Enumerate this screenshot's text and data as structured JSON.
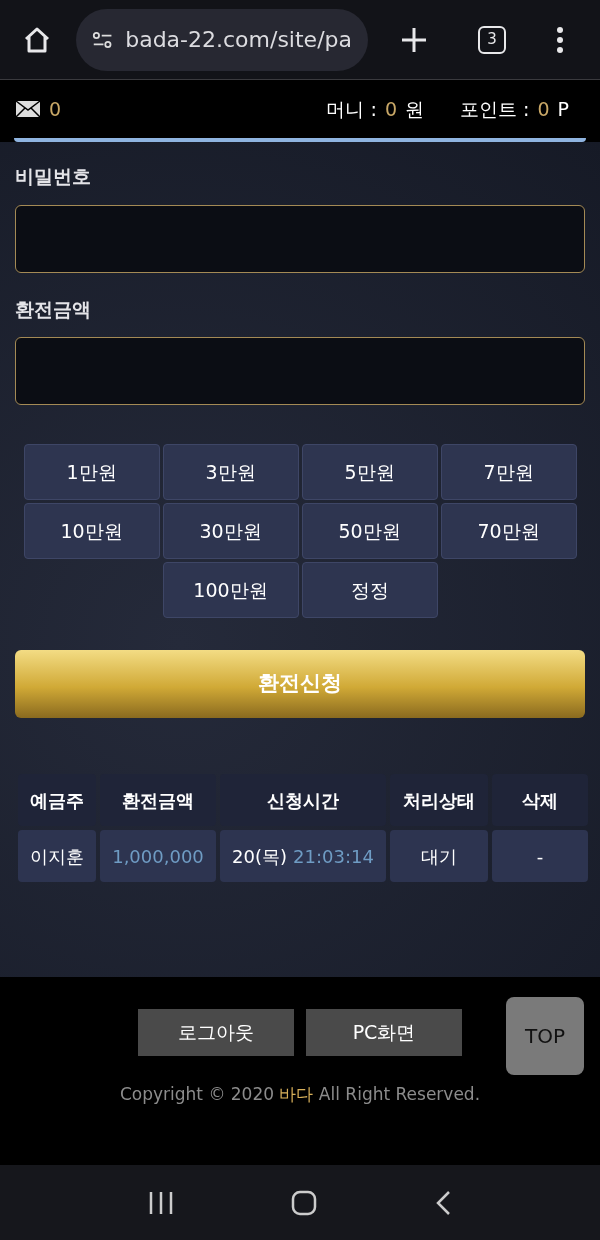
{
  "browser": {
    "url": "bada-22.com/site/pa",
    "tab_count": "3"
  },
  "top_bar": {
    "messages": "0",
    "money_label": "머니 :",
    "money_value": "0",
    "money_unit": "원",
    "point_label": "포인트 :",
    "point_value": "0",
    "point_unit": "P"
  },
  "form": {
    "password_label": "비밀번호",
    "amount_label": "환전금액"
  },
  "amount_buttons": [
    "1만원",
    "3만원",
    "5만원",
    "7만원",
    "10만원",
    "30만원",
    "50만원",
    "70만원",
    "100만원",
    "정정"
  ],
  "submit": "환전신청",
  "table": {
    "columns": [
      "예금주",
      "환전금액",
      "신청시간",
      "처리상태",
      "삭제"
    ],
    "rows": [
      {
        "holder": "이지훈",
        "amount": "1,000,000",
        "date": "20(목)",
        "time": "21:03:14",
        "status": "대기",
        "delete": "-"
      }
    ]
  },
  "footer": {
    "buttons": [
      "로그아웃",
      "PC화면"
    ],
    "top": "TOP",
    "copyright_pre": "Copyright © 2020",
    "brand": "바다",
    "copyright_post": "All Right Reserved."
  }
}
